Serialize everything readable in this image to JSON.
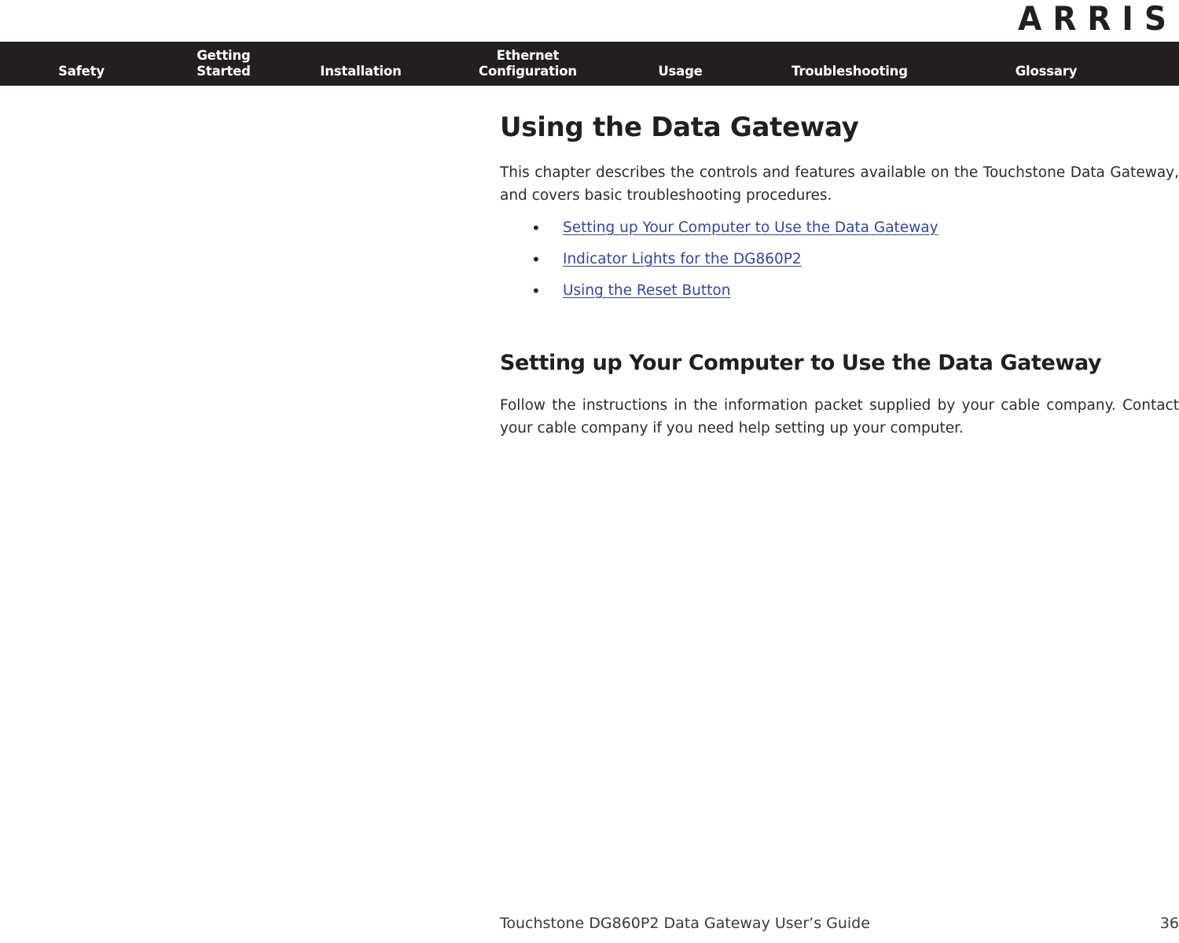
{
  "brand": {
    "logo_text": "ARRIS"
  },
  "nav": {
    "items": [
      {
        "label": "Safety"
      },
      {
        "label": "Getting\nStarted"
      },
      {
        "label": "Installation"
      },
      {
        "label": "Ethernet\nConfiguration"
      },
      {
        "label": "Usage"
      },
      {
        "label": "Troubleshooting"
      },
      {
        "label": "Glossary"
      }
    ]
  },
  "main": {
    "page_title": "Using the Data Gateway",
    "intro_paragraph": "This chapter describes the controls and features available on the Touchstone Data Gateway, and covers basic troubleshooting procedures.",
    "bullet_glyph": "•",
    "links": [
      {
        "label": "Setting up Your Computer to Use the Data Gateway"
      },
      {
        "label": "Indicator Lights for the DG860P2"
      },
      {
        "label": "Using the Reset Button"
      }
    ],
    "section_title": "Setting up Your Computer to Use the Data Gateway",
    "section_paragraph": "Follow the instructions in the information packet supplied by your cable company. Contact your cable company if you need help setting up your computer."
  },
  "footer": {
    "document_title": "Touchstone DG860P2 Data Gateway User’s Guide",
    "page_number": "36"
  },
  "colors": {
    "nav_background": "#231f20",
    "link": "#31479e",
    "text": "#231f20"
  }
}
